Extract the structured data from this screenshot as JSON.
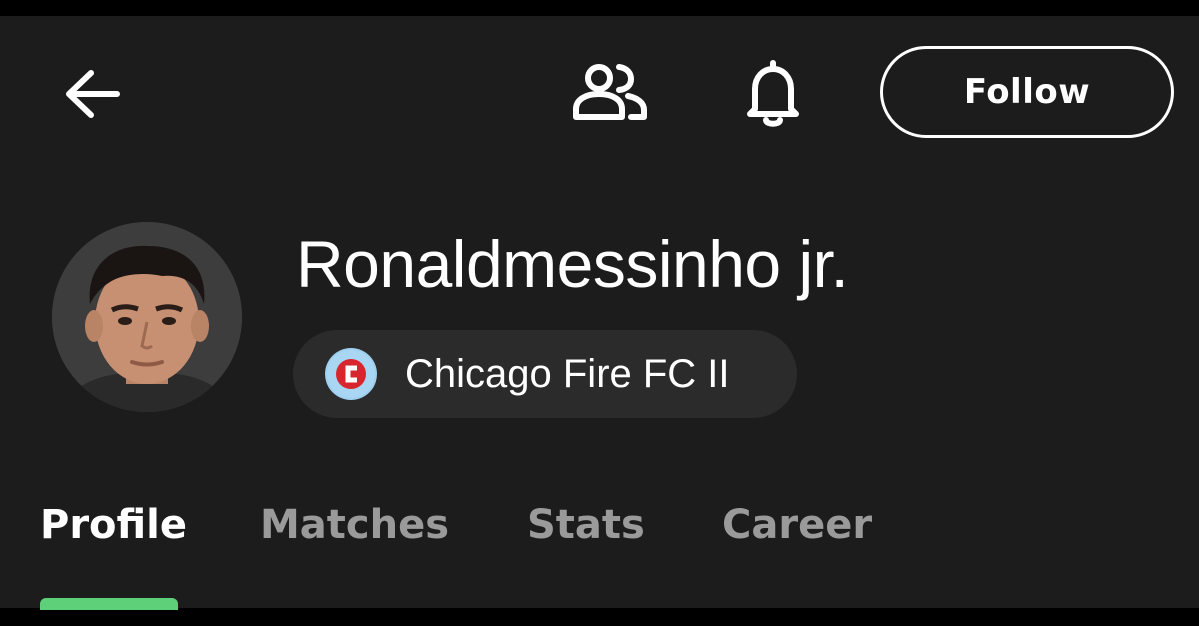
{
  "header": {
    "back_icon": "arrow-left-icon",
    "friends_icon": "people-icon",
    "notifications_icon": "bell-icon",
    "follow_label": "Follow"
  },
  "player": {
    "name": "Ronaldmessinho jr.",
    "avatar_icon": "player-photo",
    "team": {
      "name": "Chicago Fire FC II",
      "crest_icon": "team-crest-icon",
      "crest_color": "#9fd0f0"
    }
  },
  "tabs": [
    {
      "label": "Profile",
      "active": true
    },
    {
      "label": "Matches",
      "active": false
    },
    {
      "label": "Stats",
      "active": false
    },
    {
      "label": "Career",
      "active": false
    }
  ],
  "colors": {
    "background": "#1c1c1c",
    "accent": "#5ed07a",
    "chip_bg": "#2b2b2b",
    "inactive_tab": "#9a9a9a"
  }
}
